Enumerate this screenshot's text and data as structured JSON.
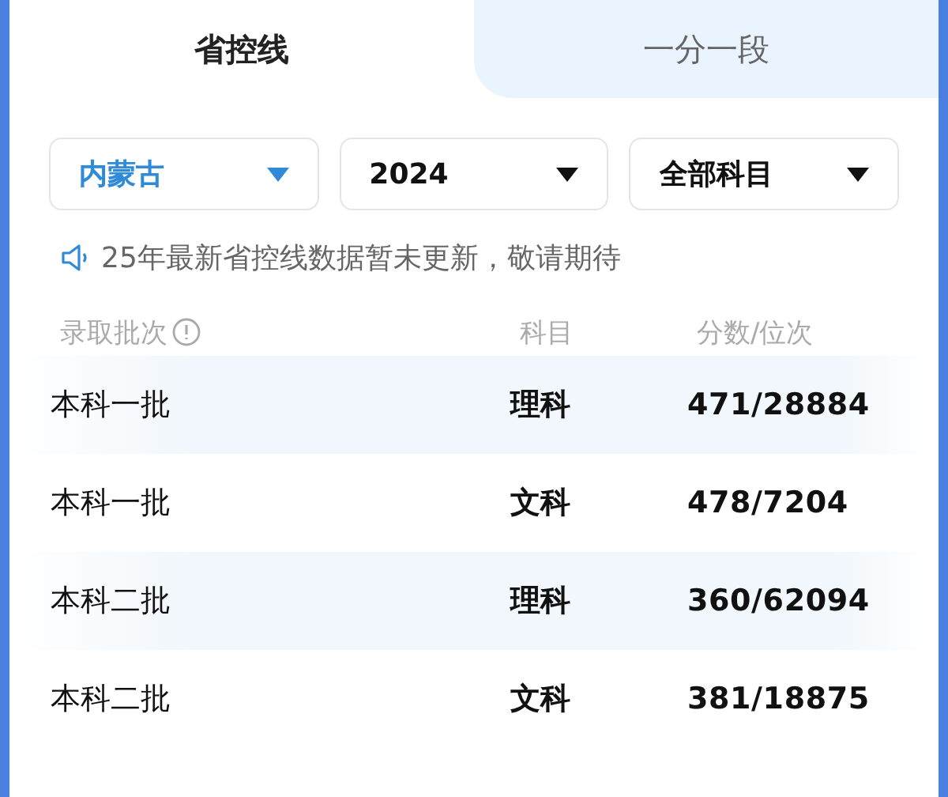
{
  "tabs": [
    {
      "label": "省控线",
      "selected": true
    },
    {
      "label": "一分一段",
      "selected": false
    }
  ],
  "filters": [
    {
      "value": "内蒙古",
      "active": true
    },
    {
      "value": "2024",
      "active": false
    },
    {
      "value": "全部科目",
      "active": false
    }
  ],
  "notice": "25年最新省控线数据暂未更新，敬请期待",
  "table": {
    "columns": [
      "录取批次",
      "科目",
      "分数/位次"
    ],
    "rows": [
      {
        "batch": "本科一批",
        "subject": "理科",
        "score": "471/28884"
      },
      {
        "batch": "本科一批",
        "subject": "文科",
        "score": "478/7204"
      },
      {
        "batch": "本科二批",
        "subject": "理科",
        "score": "360/62094"
      },
      {
        "batch": "本科二批",
        "subject": "文科",
        "score": "381/18875"
      }
    ]
  }
}
